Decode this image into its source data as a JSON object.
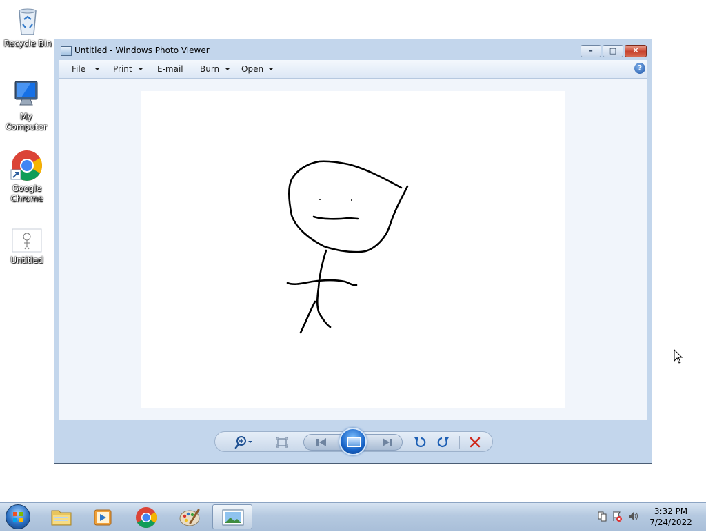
{
  "desktop": {
    "icons": [
      {
        "label": "Recycle Bin",
        "icon": "recycle-bin-icon"
      },
      {
        "label": "My Computer",
        "icon": "computer-icon"
      },
      {
        "label": "Google Chrome",
        "icon": "chrome-icon"
      },
      {
        "label": "Untitled",
        "icon": "image-file-icon"
      }
    ]
  },
  "window": {
    "title": "Untitled - Windows Photo Viewer",
    "menu": {
      "file": "File",
      "print": "Print",
      "email": "E-mail",
      "burn": "Burn",
      "open": "Open"
    },
    "help_glyph": "?"
  },
  "taskbar": {
    "apps": [
      "windows-explorer-icon",
      "media-player-icon",
      "chrome-icon",
      "paint-icon",
      "photo-viewer-icon"
    ],
    "active_app": "photo-viewer-icon",
    "clock_time": "3:32 PM",
    "clock_date": "7/24/2022"
  }
}
